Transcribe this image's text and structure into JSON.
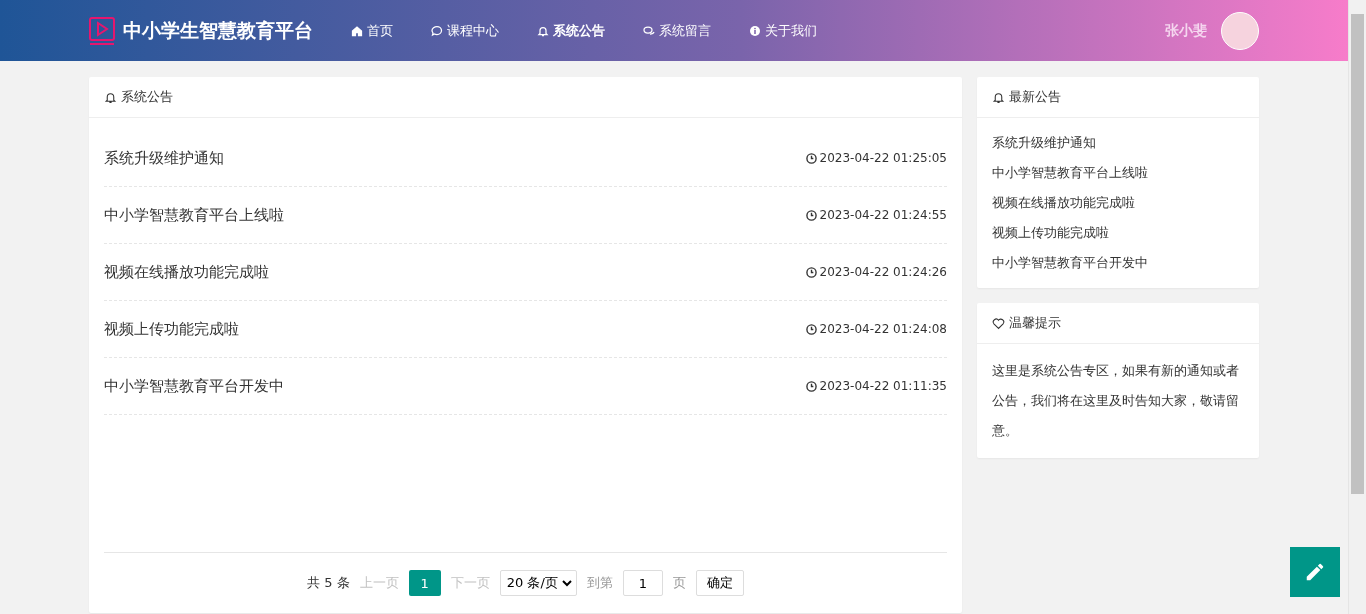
{
  "header": {
    "brand": "中小学生智慧教育平台",
    "nav": [
      {
        "label": "首页",
        "kind": "home",
        "selected": false
      },
      {
        "label": "课程中心",
        "kind": "chat",
        "selected": false
      },
      {
        "label": "系统公告",
        "kind": "bell",
        "selected": true
      },
      {
        "label": "系统留言",
        "kind": "chats",
        "selected": false
      },
      {
        "label": "关于我们",
        "kind": "info",
        "selected": false
      }
    ],
    "user": {
      "name": "张小斐"
    }
  },
  "notices": {
    "title": "系统公告",
    "items": [
      {
        "title": "系统升级维护通知",
        "time": "2023-04-22 01:25:05"
      },
      {
        "title": "中小学智慧教育平台上线啦",
        "time": "2023-04-22 01:24:55"
      },
      {
        "title": "视频在线播放功能完成啦",
        "time": "2023-04-22 01:24:26"
      },
      {
        "title": "视频上传功能完成啦",
        "time": "2023-04-22 01:24:08"
      },
      {
        "title": "中小学智慧教育平台开发中",
        "time": "2023-04-22 01:11:35"
      }
    ],
    "pagination": {
      "total": "共 5 条",
      "prev": "上一页",
      "pages": [
        {
          "label": "1",
          "selected": true
        }
      ],
      "next": "下一页",
      "page_size": "20 条/页",
      "goto": "到第",
      "goto_value": "1",
      "page_unit": "页",
      "confirm": "确定"
    }
  },
  "latest": {
    "title": "最新公告",
    "items": [
      "系统升级维护通知",
      "中小学智慧教育平台上线啦",
      "视频在线播放功能完成啦",
      "视频上传功能完成啦",
      "中小学智慧教育平台开发中"
    ]
  },
  "tips": {
    "title": "温馨提示",
    "text": "这里是系统公告专区，如果有新的通知或者公告，我们将在这里及时告知大家，敬请留意。"
  }
}
